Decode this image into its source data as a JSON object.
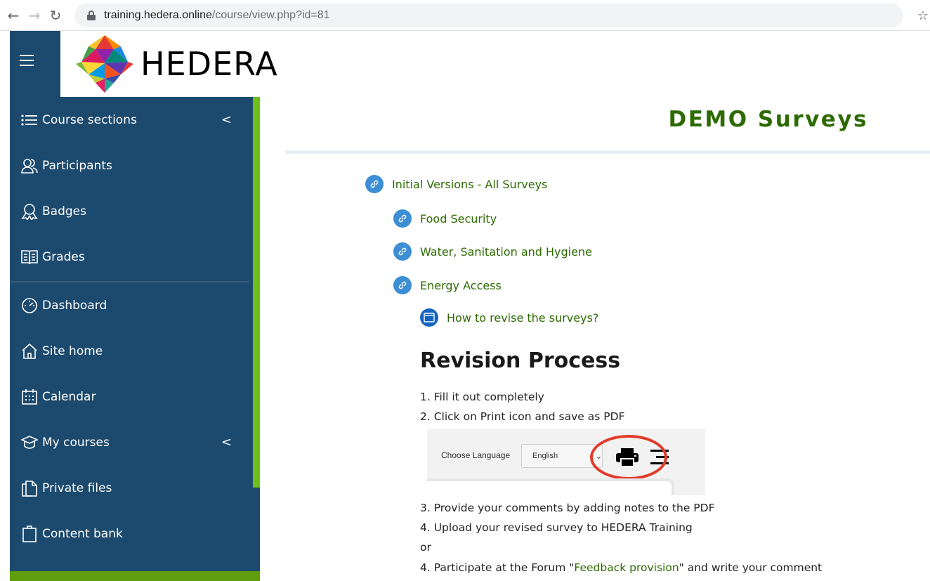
{
  "browser": {
    "url_host": "training.hedera.online",
    "url_path": "/course/view.php?id=81"
  },
  "logo": {
    "text": "HEDERA"
  },
  "sidebar": {
    "items": [
      {
        "label": "Course sections",
        "icon": "list-icon"
      },
      {
        "label": "Participants",
        "icon": "users-icon"
      },
      {
        "label": "Badges",
        "icon": "badge-icon"
      },
      {
        "label": "Grades",
        "icon": "grades-icon"
      },
      {
        "label": "Dashboard",
        "icon": "dashboard-icon"
      },
      {
        "label": "Site home",
        "icon": "home-icon"
      },
      {
        "label": "Calendar",
        "icon": "calendar-icon"
      },
      {
        "label": "My courses",
        "icon": "graduation-cap-icon"
      },
      {
        "label": "Private files",
        "icon": "files-icon"
      },
      {
        "label": "Content bank",
        "icon": "clipboard-icon"
      }
    ]
  },
  "course": {
    "title": "DEMO Surveys"
  },
  "activities": [
    {
      "label": "Initial Versions - All Surveys",
      "icon": "link-icon"
    },
    {
      "label": "Food Security",
      "icon": "link-icon"
    },
    {
      "label": "Water, Sanitation and Hygiene",
      "icon": "link-icon"
    },
    {
      "label": "Energy Access",
      "icon": "link-icon"
    },
    {
      "label": "How to revise the surveys?",
      "icon": "page-icon"
    }
  ],
  "revision": {
    "heading": "Revision Process",
    "step1": "1. Fill it out completely",
    "step2": "2. Click on Print icon and save as PDF",
    "step3": "3. Provide your comments by adding notes to the PDF",
    "step4a": "4. Upload your revised survey to HEDERA Training",
    "or": "or",
    "step4b_prefix": "4. Participate at the Forum \"",
    "step4b_link": "Feedback provision",
    "step4b_suffix": "\" and write your comment"
  },
  "screenshot": {
    "choose_language": "Choose Language",
    "language_value": "English"
  },
  "colors": {
    "sidebar_bg": "#1c4a6e",
    "accent_green": "#6dbf1b",
    "link_green": "#2d6b00",
    "icon_blue": "#3d8ed4"
  }
}
